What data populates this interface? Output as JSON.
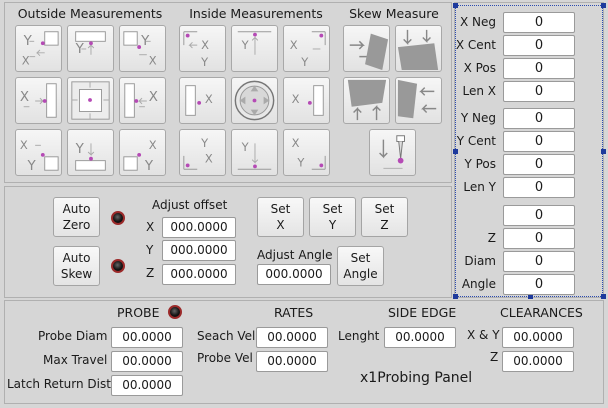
{
  "sections": {
    "outside": "Outside Measurements",
    "inside": "Inside Measurements",
    "skew": "Skew Measure"
  },
  "dro": [
    {
      "label": "X Neg",
      "value": "0"
    },
    {
      "label": "X Cent",
      "value": "0"
    },
    {
      "label": "X Pos",
      "value": "0"
    },
    {
      "label": "Len X",
      "value": "0"
    },
    {
      "label": "Y Neg",
      "value": "0"
    },
    {
      "label": "Y Cent",
      "value": "0"
    },
    {
      "label": "Y Pos",
      "value": "0"
    },
    {
      "label": "Len Y",
      "value": "0"
    },
    {
      "label": "",
      "value": "0"
    },
    {
      "label": "Z",
      "value": "0"
    },
    {
      "label": "Diam",
      "value": "0"
    },
    {
      "label": "Angle",
      "value": "0"
    }
  ],
  "controls": {
    "auto_zero": [
      "Auto",
      "Zero"
    ],
    "auto_skew": [
      "Auto",
      "Skew"
    ],
    "adjust_offset": "Adjust offset",
    "x_label": "X",
    "y_label": "Y",
    "z_label": "Z",
    "offset_x": "000.0000",
    "offset_y": "000.0000",
    "offset_z": "000.0000",
    "set_x": [
      "Set",
      "X"
    ],
    "set_y": [
      "Set",
      "Y"
    ],
    "set_z": [
      "Set",
      "Z"
    ],
    "adjust_angle": "Adjust Angle",
    "angle_value": "000.0000",
    "set_angle": [
      "Set",
      "Angle"
    ]
  },
  "probe": {
    "title": "PROBE",
    "diam_label": "Probe Diam",
    "diam": "00.0000",
    "travel_label": "Max Travel",
    "travel": "00.0000",
    "latch_label": "Latch Return Dist",
    "latch": "00.0000"
  },
  "rates": {
    "title": "RATES",
    "search_label": "Seach Vel",
    "search": "00.0000",
    "probe_label": "Probe Vel",
    "probe": "00.0000"
  },
  "side_edge": {
    "title": "SIDE EDGE",
    "length_label": "Lenght",
    "length": "00.0000"
  },
  "clearances": {
    "title": "CLEARANCES",
    "xy_label": "X & Y",
    "xy": "00.0000",
    "z_label": "Z",
    "z": "00.0000"
  },
  "panel_title": "x1Probing  Panel",
  "colors": {
    "probe_tip": "#b54ab5",
    "led_ring": "#9b2a2a",
    "selection": "#1e3a9c"
  }
}
